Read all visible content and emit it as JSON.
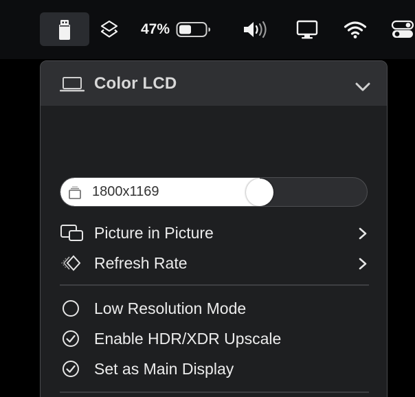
{
  "menubar": {
    "battery_percent": "47%",
    "battery_level": 0.47,
    "icons": [
      "display-app-icon",
      "layers-icon",
      "battery-icon",
      "volume-icon",
      "display-icon",
      "wifi-icon",
      "control-center-icon"
    ]
  },
  "panel": {
    "display_name": "Color LCD",
    "resolution": {
      "label": "1800x1169",
      "level": 0.65
    },
    "menu_items": [
      {
        "label": "Picture in Picture",
        "icon": "picture-in-picture-icon",
        "has_submenu": true
      },
      {
        "label": "Refresh Rate",
        "icon": "refresh-rate-icon",
        "has_submenu": true
      }
    ],
    "options": [
      {
        "label": "Low Resolution Mode",
        "checked": false
      },
      {
        "label": "Enable HDR/XDR Upscale",
        "checked": true
      },
      {
        "label": "Set as Main Display",
        "checked": true
      }
    ]
  },
  "colors": {
    "menubar_bg": "#0c0d0f",
    "panel_bg": "#1e1f21",
    "header_bg": "#2f3033",
    "text": "#ececec",
    "slider_fill": "#ffffff"
  }
}
